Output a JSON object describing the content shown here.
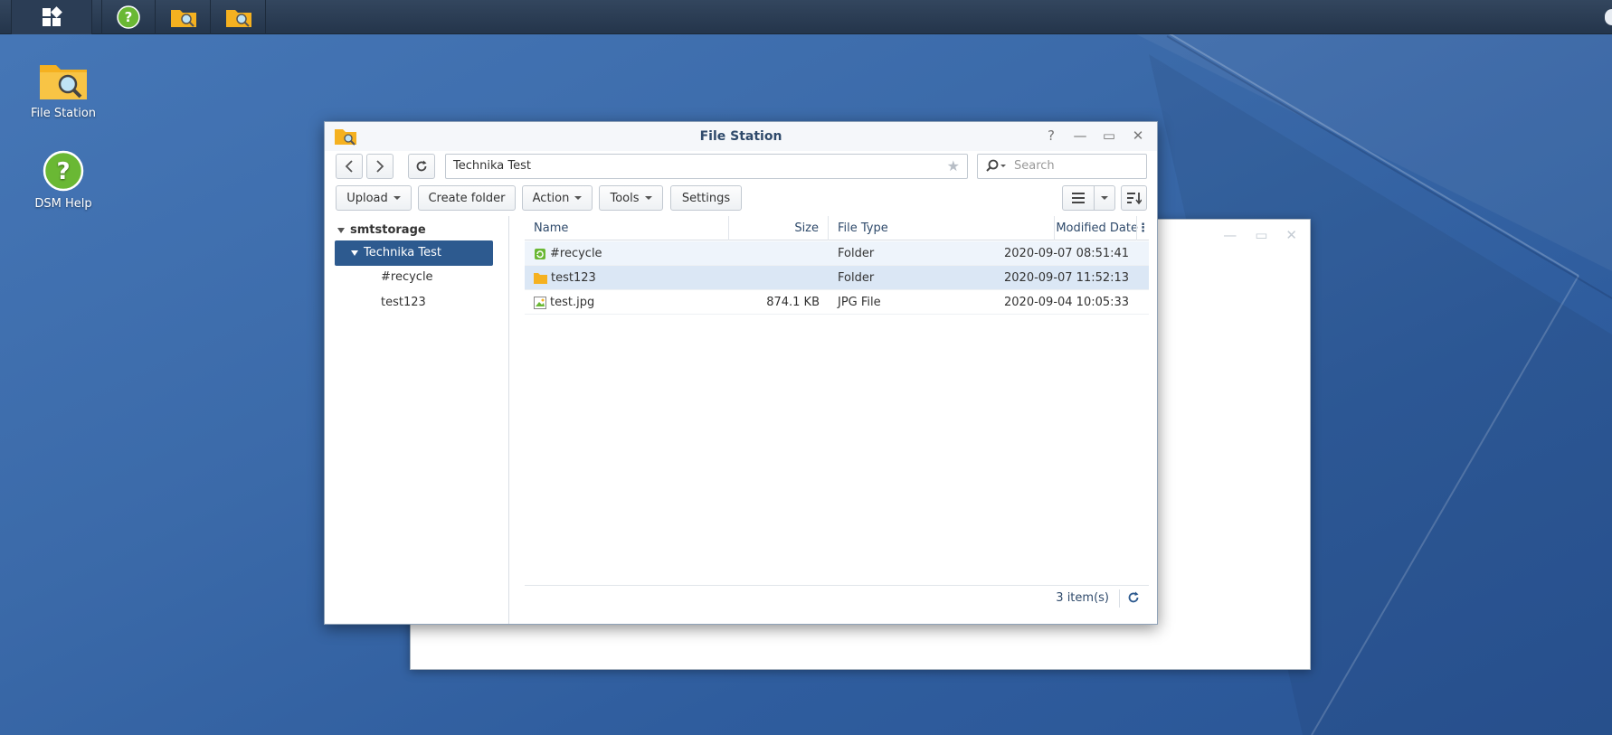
{
  "taskbar": {
    "items": [
      {
        "name": "main-menu",
        "icon": "grid-icon"
      },
      {
        "name": "dsm-help",
        "icon": "help-icon"
      },
      {
        "name": "file-station-1",
        "icon": "folder-search-icon"
      },
      {
        "name": "file-station-2",
        "icon": "folder-search-icon"
      }
    ]
  },
  "desktop": {
    "icons": [
      {
        "label": "File Station",
        "icon": "folder-search-icon"
      },
      {
        "label": "DSM Help",
        "icon": "help-icon"
      }
    ]
  },
  "window": {
    "title": "File Station",
    "path": "Technika Test",
    "search_placeholder": "Search",
    "toolbar": {
      "upload": "Upload",
      "create_folder": "Create folder",
      "action": "Action",
      "tools": "Tools",
      "settings": "Settings"
    },
    "tree": {
      "root": "smtstorage",
      "selected": "Technika Test",
      "children": [
        "#recycle",
        "test123"
      ]
    },
    "columns": {
      "name": "Name",
      "size": "Size",
      "type": "File Type",
      "date": "Modified Date"
    },
    "files": [
      {
        "name": "#recycle",
        "size": "",
        "type": "Folder",
        "date": "2020-09-07 08:51:41",
        "icon": "recycle-folder-icon"
      },
      {
        "name": "test123",
        "size": "",
        "type": "Folder",
        "date": "2020-09-07 11:52:13",
        "icon": "folder-icon"
      },
      {
        "name": "test.jpg",
        "size": "874.1 KB",
        "type": "JPG File",
        "date": "2020-09-04 10:05:33",
        "icon": "image-file-icon"
      }
    ],
    "status": "3 item(s)"
  },
  "colors": {
    "desktop": "#3b6aa9",
    "taskbar": "#2a3c53",
    "selection": "#2d5a8f",
    "title": "#2f4a6b",
    "folder": "#f5b120"
  }
}
